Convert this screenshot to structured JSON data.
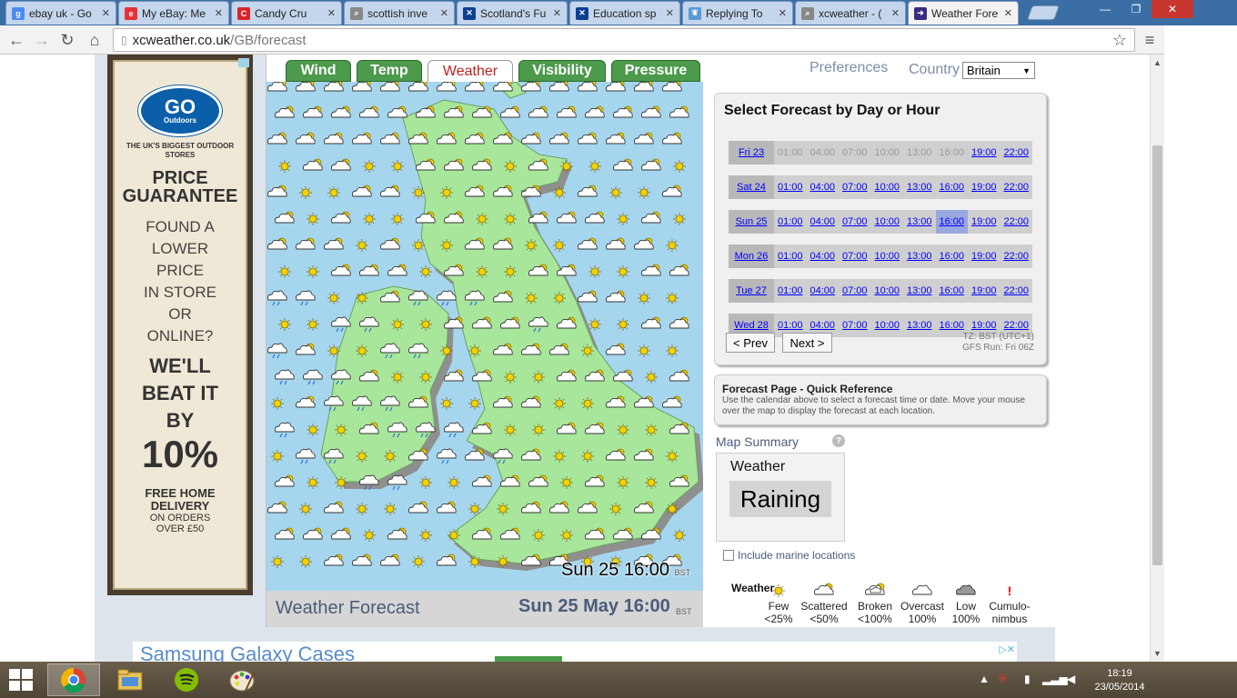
{
  "browser": {
    "tabs": [
      {
        "title": "ebay uk - Go",
        "fav_color": "#4c8bf5",
        "fav_letter": "g"
      },
      {
        "title": "My eBay: Me",
        "fav_color": "#e53238",
        "fav_letter": "e"
      },
      {
        "title": "Candy Cru",
        "fav_color": "#d8232a",
        "fav_letter": "C"
      },
      {
        "title": "scottish inve",
        "fav_color": "#888888",
        "fav_letter": "⌕"
      },
      {
        "title": "Scotland's Fu",
        "fav_color": "#0b3f91",
        "fav_letter": "✕"
      },
      {
        "title": "Education sp",
        "fav_color": "#0b3f91",
        "fav_letter": "✕"
      },
      {
        "title": "Replying To",
        "fav_color": "#5a9bd4",
        "fav_letter": "❦"
      },
      {
        "title": "xcweather - (",
        "fav_color": "#888888",
        "fav_letter": "⌕"
      },
      {
        "title": "Weather Fore",
        "fav_color": "#3a2a80",
        "fav_letter": "➜"
      }
    ],
    "url_host": "xcweather.co.uk",
    "url_path": "/GB/forecast"
  },
  "ad": {
    "logo_main": "GO",
    "logo_sub": "Outdoors",
    "tagline": "THE UK'S BIGGEST OUTDOOR STORES",
    "price_line1": "PRICE",
    "price_line2": "GUARANTEE",
    "find_text": [
      "FOUND A",
      "LOWER",
      "PRICE",
      "IN STORE",
      "OR",
      "ONLINE?"
    ],
    "beat_line1": "WE'LL",
    "beat_line2": "BEAT IT",
    "beat_line3": "BY",
    "percent": "10%",
    "free_line1": "FREE HOME",
    "free_line2": "DELIVERY",
    "orders_line1": "ON ORDERS",
    "orders_line2": "OVER £50"
  },
  "nav": {
    "tabs": [
      "Wind",
      "Temp",
      "Weather",
      "Visibility",
      "Pressure"
    ],
    "active": "Weather",
    "preferences": "Preferences",
    "country_label": "Country",
    "country_value": "Britain"
  },
  "forecast": {
    "title": "Select Forecast by Day or Hour",
    "hours": [
      "01:00",
      "04:00",
      "07:00",
      "10:00",
      "13:00",
      "16:00",
      "19:00",
      "22:00"
    ],
    "days": [
      {
        "label": "Fri 23",
        "available": [
          false,
          false,
          false,
          false,
          false,
          false,
          true,
          true
        ],
        "selected": -1
      },
      {
        "label": "Sat 24",
        "available": [
          true,
          true,
          true,
          true,
          true,
          true,
          true,
          true
        ],
        "selected": -1
      },
      {
        "label": "Sun 25",
        "available": [
          true,
          true,
          true,
          true,
          true,
          true,
          true,
          true
        ],
        "selected": 5
      },
      {
        "label": "Mon 26",
        "available": [
          true,
          true,
          true,
          true,
          true,
          true,
          true,
          true
        ],
        "selected": -1
      },
      {
        "label": "Tue 27",
        "available": [
          true,
          true,
          true,
          true,
          true,
          true,
          true,
          true
        ],
        "selected": -1
      },
      {
        "label": "Wed 28",
        "available": [
          true,
          true,
          true,
          true,
          true,
          true,
          true,
          true
        ],
        "selected": -1
      }
    ],
    "prev": "< Prev",
    "next": "Next >",
    "tz": "TZ: BST (UTC+1)",
    "gfs": "GFS Run: Fri 06Z"
  },
  "quickref": {
    "title": "Forecast Page - Quick Reference",
    "body": "Use the calendar above to select a forecast time or date. Move your mouse over the map to display the forecast at each location."
  },
  "map": {
    "label_time": "Sun 25 16:00",
    "label_tz": "BST",
    "footer_title": "Weather Forecast",
    "footer_time": "Sun 25 May 16:00",
    "footer_tz": "BST"
  },
  "summary": {
    "title": "Map Summary",
    "field_label": "Weather",
    "value": "Raining",
    "marine": "Include marine locations"
  },
  "legend": {
    "title": "Weather",
    "items": [
      {
        "name": "Few",
        "pct": "<25%",
        "icon": "sun"
      },
      {
        "name": "Scattered",
        "pct": "<50%",
        "icon": "scattered"
      },
      {
        "name": "Broken",
        "pct": "<100%",
        "icon": "broken"
      },
      {
        "name": "Overcast",
        "pct": "100%",
        "icon": "overcast"
      },
      {
        "name": "Low",
        "pct": "100%",
        "icon": "low"
      },
      {
        "name": "Cumulo-",
        "pct": "nimbus",
        "icon": "cb"
      }
    ]
  },
  "bottom_ad": {
    "text": "Samsung Galaxy Cases"
  },
  "taskbar": {
    "time": "18:19",
    "date": "23/05/2014"
  },
  "colors": {
    "sea": "#a6d6ee",
    "land": "#a8e69c",
    "tab_green": "#4c9a4c",
    "link": "#0000ff",
    "accent_text": "#4a5c7a"
  }
}
